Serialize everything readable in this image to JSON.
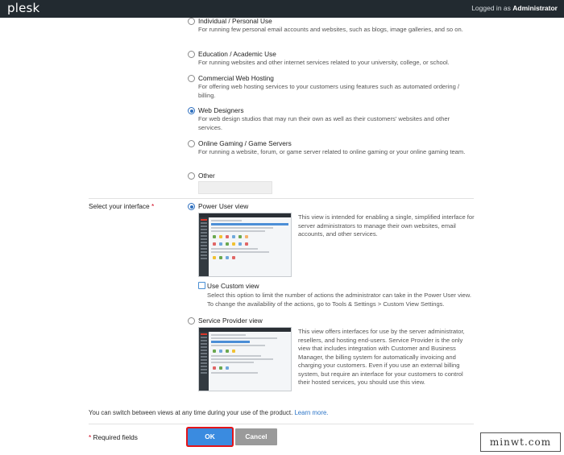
{
  "header": {
    "logo": "plesk",
    "logged_in_prefix": "Logged in as",
    "username": "Administrator"
  },
  "purpose_options": [
    {
      "label": "Individual / Personal Use",
      "desc": "For running few personal email accounts and websites, such as blogs, image galleries, and so on.",
      "selected": false
    },
    {
      "label": "Education / Academic Use",
      "desc": "For running websites and other internet services related to your university, college, or school.",
      "selected": false
    },
    {
      "label": "Commercial Web Hosting",
      "desc": "For offering web hosting services to your customers using features such as automated ordering / billing.",
      "selected": false
    },
    {
      "label": "Web Designers",
      "desc": "For web design studios that may run their own as well as their customers' websites and other services.",
      "selected": true
    },
    {
      "label": "Online Gaming / Game Servers",
      "desc": "For running a website, forum, or game server related to online gaming or your online gaming team.",
      "selected": false
    },
    {
      "label": "Other",
      "desc": "",
      "selected": false
    }
  ],
  "interface": {
    "label": "Select your interface",
    "required_mark": "*",
    "power_user": {
      "label": "Power User view",
      "selected": true,
      "desc": "This view is intended for enabling a single, simplified interface for server administrators to manage their own websites, email accounts, and other services."
    },
    "custom_view": {
      "label": "Use Custom view",
      "checked": false,
      "desc": "Select this option to limit the number of actions the administrator can take in the Power User view. To change the availability of the actions, go to Tools & Settings > Custom View Settings."
    },
    "service_provider": {
      "label": "Service Provider view",
      "selected": false,
      "desc": "This view offers interfaces for use by the server administrator, resellers, and hosting end-users. Service Provider is the only view that includes integration with Customer and Business Manager, the billing system for automatically invoicing and charging your customers. Even if you use an external billing system, but require an interface for your customers to control their hosted services, you should use this view."
    },
    "switch_note": "You can switch between views at any time during your use of the product.",
    "learn_more": "Learn more."
  },
  "footer": {
    "required_mark": "*",
    "required_text": "Required fields",
    "ok_label": "OK",
    "cancel_label": "Cancel"
  },
  "watermark": "minwt.com",
  "colors": {
    "topbar": "#222a30",
    "accent": "#3a8be0",
    "ok_highlight": "#e3151a",
    "cancel": "#9a9a9a",
    "link": "#2b74c7",
    "required": "#d0021b"
  }
}
